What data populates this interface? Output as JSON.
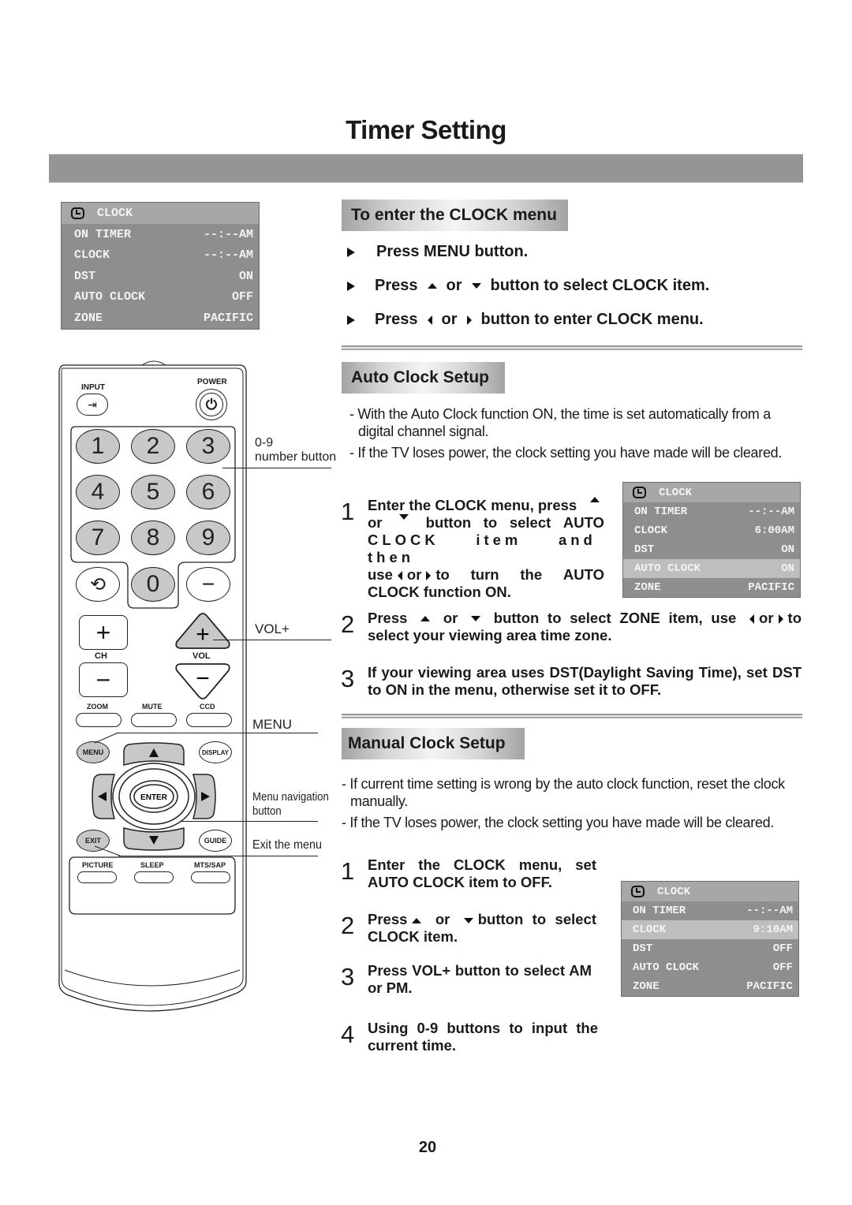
{
  "page": {
    "title": "Timer Setting",
    "page_number": "20"
  },
  "osd_initial": {
    "header": "CLOCK",
    "header_icon": "clock-icon",
    "rows": [
      {
        "label": "ON TIMER",
        "value": "--:--AM",
        "selected": false
      },
      {
        "label": "CLOCK",
        "value": "--:--AM",
        "selected": false
      },
      {
        "label": "DST",
        "value": "ON",
        "selected": false
      },
      {
        "label": "AUTO CLOCK",
        "value": "OFF",
        "selected": false
      },
      {
        "label": "ZONE",
        "value": "PACIFIC",
        "selected": false
      }
    ]
  },
  "enter_clock": {
    "heading": "To enter the CLOCK menu",
    "bullets": [
      {
        "parts": [
          "Press MENU button."
        ]
      },
      {
        "parts": [
          "Press",
          "up",
          "or",
          "down",
          "button to select CLOCK item."
        ]
      },
      {
        "parts": [
          "Press",
          "left",
          "or",
          "right",
          "button to enter CLOCK menu."
        ]
      }
    ]
  },
  "auto_clock": {
    "heading": "Auto Clock Setup",
    "notes": [
      {
        "line1": "- With the Auto Clock function ON, the time is set automatically from a",
        "line2": "digital channel signal."
      },
      {
        "line1": "- If the TV loses power, the clock setting you have made will be cleared."
      }
    ],
    "steps": [
      {
        "num": "1",
        "text": "Enter the CLOCK menu, press ▲ or ▼ button to select AUTO CLOCK item and then use ◀ or ▶ to turn the AUTO CLOCK function ON."
      },
      {
        "num": "2",
        "text": "Press ▲ or ▼ button to select ZONE item, use ◀ or ▶ to select your viewing area time zone."
      },
      {
        "num": "3",
        "text": "If your viewing area uses DST(Daylight Saving Time), set DST to ON in the menu, otherwise set it to OFF."
      }
    ],
    "osd": {
      "header": "CLOCK",
      "rows": [
        {
          "label": "ON TIMER",
          "value": "--:--AM",
          "selected": false
        },
        {
          "label": "CLOCK",
          "value": "6:00AM",
          "selected": false
        },
        {
          "label": "DST",
          "value": "ON",
          "selected": false
        },
        {
          "label": "AUTO CLOCK",
          "value": "ON",
          "selected": true
        },
        {
          "label": "ZONE",
          "value": "PACIFIC",
          "selected": false
        }
      ]
    }
  },
  "manual_clock": {
    "heading": "Manual Clock Setup",
    "notes": [
      {
        "line1": "- If current time setting is wrong by the auto clock function, reset the clock",
        "line2": "manually."
      },
      {
        "line1": "- If the TV loses power, the clock setting you have made will be cleared."
      }
    ],
    "steps": [
      {
        "num": "1",
        "text": "Enter the CLOCK menu, set AUTO CLOCK item to OFF."
      },
      {
        "num": "2",
        "text": "Press ▲ or ▼ button to select CLOCK item."
      },
      {
        "num": "3",
        "text": "Press VOL+ button to select AM or PM."
      },
      {
        "num": "4",
        "text": "Using 0-9 buttons to input the current time."
      }
    ],
    "osd": {
      "header": "CLOCK",
      "rows": [
        {
          "label": "ON TIMER",
          "value": "--:--AM",
          "selected": false
        },
        {
          "label": "CLOCK",
          "value": "9:10AM",
          "selected": true
        },
        {
          "label": "DST",
          "value": "OFF",
          "selected": false
        },
        {
          "label": "AUTO CLOCK",
          "value": "OFF",
          "selected": false
        },
        {
          "label": "ZONE",
          "value": "PACIFIC",
          "selected": false
        }
      ]
    }
  },
  "remote": {
    "input_label": "INPUT",
    "power_label": "POWER",
    "digits": [
      "1",
      "2",
      "3",
      "4",
      "5",
      "6",
      "7",
      "8",
      "9",
      "0"
    ],
    "dash": "−",
    "ch_label": "CH",
    "vol_label": "VOL",
    "plus": "+",
    "minus": "−",
    "row_zoom": [
      "ZOOM",
      "MUTE",
      "CCD"
    ],
    "menu_label": "MENU",
    "display_label": "DISPLAY",
    "enter_label": "ENTER",
    "exit_label": "EXIT",
    "guide_label": "GUIDE",
    "row_picture": [
      "PICTURE",
      "SLEEP",
      "MTS/SAP"
    ]
  },
  "callouts": {
    "number": [
      "0-9",
      "number button"
    ],
    "vol": "VOL+",
    "menu": "MENU",
    "nav": [
      "Menu navigation",
      "button"
    ],
    "exit": "Exit the menu"
  },
  "colors": {
    "osd_bg": "#8f8d8d",
    "osd_header": "#a9a6a6",
    "osd_selected": "#c0bdbd",
    "title_bar": "#969494",
    "button_fill": "#c8c8c8"
  }
}
